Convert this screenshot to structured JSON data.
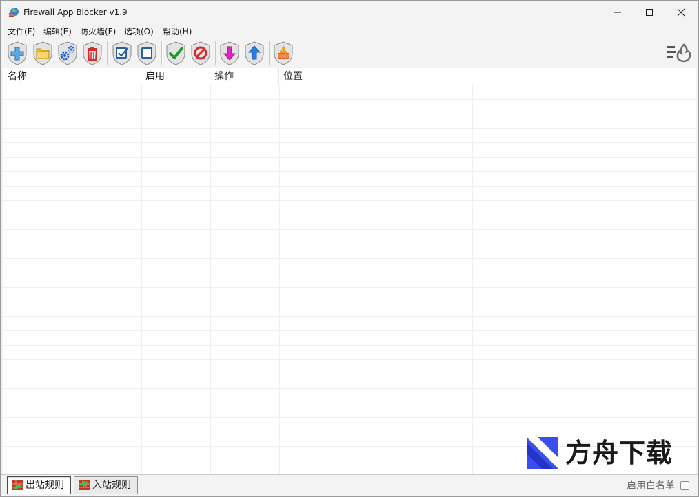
{
  "window": {
    "title": "Firewall App Blocker v1.9"
  },
  "menu": {
    "items": [
      {
        "label": "文件(F)"
      },
      {
        "label": "编辑(E)"
      },
      {
        "label": "防火墙(F)"
      },
      {
        "label": "选项(O)"
      },
      {
        "label": "帮助(H)"
      }
    ]
  },
  "toolbar": {
    "buttons": [
      {
        "icon": "add-icon"
      },
      {
        "icon": "folder-icon"
      },
      {
        "icon": "gears-icon"
      },
      {
        "icon": "trash-icon"
      },
      {
        "icon": "check-all-icon"
      },
      {
        "icon": "uncheck-all-icon"
      },
      {
        "icon": "allow-icon"
      },
      {
        "icon": "block-icon"
      },
      {
        "icon": "move-down-icon"
      },
      {
        "icon": "move-up-icon"
      },
      {
        "icon": "firewall-icon"
      }
    ],
    "right_icon": "firewall-menu-icon"
  },
  "list": {
    "columns": [
      {
        "label": "名称"
      },
      {
        "label": "启用"
      },
      {
        "label": "操作"
      },
      {
        "label": "位置"
      }
    ],
    "rows": []
  },
  "tabs": [
    {
      "label": "出站规则",
      "active": true
    },
    {
      "label": "入站规则",
      "active": false
    }
  ],
  "whitelist": {
    "label": "启用白名单",
    "checked": false
  },
  "watermark": {
    "text": "方舟下载"
  },
  "colors": {
    "title_bg": "#f3f3f3",
    "list_bg": "#ffffff",
    "gridline": "#efefef",
    "watermark_blue": "#3b4ff0",
    "watermark_orange": "#f7a21b"
  }
}
